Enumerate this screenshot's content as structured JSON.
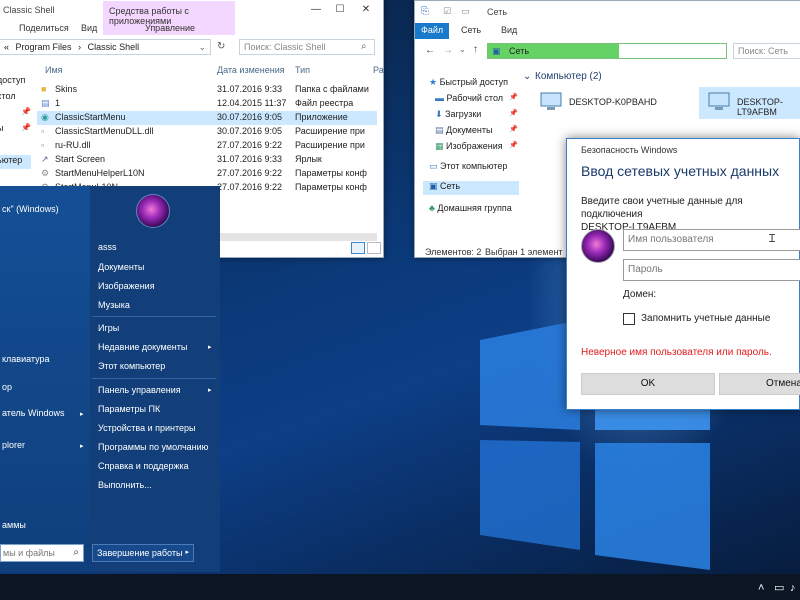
{
  "desktop": {
    "accent": "#0b3a7a",
    "logo_color": "#6fbaff"
  },
  "explorer1": {
    "title": "Classic Shell",
    "tool_tab_label": "Средства работы с приложениями",
    "tabs": [
      "Поделиться",
      "Вид",
      "Управление"
    ],
    "breadcrumb": [
      "«",
      "Program Files",
      "›",
      "Classic Shell"
    ],
    "search_placeholder": "Поиск: Classic Shell",
    "columns": [
      "Имя",
      "Дата изменения",
      "Тип",
      "Ра"
    ],
    "nav_partial": [
      "доступ",
      "стол",
      "",
      "",
      "ы",
      "ьютер"
    ],
    "files": [
      {
        "name": "Skins",
        "date": "31.07.2016 9:33",
        "type": "Папка с файлами",
        "icon": "folder-icon"
      },
      {
        "name": "1",
        "date": "12.04.2015 11:37",
        "type": "Файл реестра",
        "icon": "registry-file-icon"
      },
      {
        "name": "ClassicStartMenu",
        "date": "30.07.2016 9:05",
        "type": "Приложение",
        "icon": "app-icon"
      },
      {
        "name": "ClassicStartMenuDLL.dll",
        "date": "30.07.2016 9:05",
        "type": "Расширение при",
        "icon": "dll-icon"
      },
      {
        "name": "ru-RU.dll",
        "date": "27.07.2016 9:22",
        "type": "Расширение при",
        "icon": "dll-icon"
      },
      {
        "name": "Start Screen",
        "date": "31.07.2016 9:33",
        "type": "Ярлык",
        "icon": "shortcut-icon"
      },
      {
        "name": "StartMenuHelperL10N",
        "date": "27.07.2016 9:22",
        "type": "Параметры конф",
        "icon": "config-icon"
      },
      {
        "name": "StartMenuL10N",
        "date": "27.07.2016 9:22",
        "type": "Параметры конф",
        "icon": "config-icon"
      }
    ]
  },
  "explorer2": {
    "title": "Сеть",
    "tabs": [
      "Файл",
      "Сеть",
      "Вид"
    ],
    "address": "Сеть",
    "search_placeholder": "Поиск: Сеть",
    "nav": [
      {
        "label": "Быстрый доступ",
        "icon": "star-icon"
      },
      {
        "label": "Рабочий стол",
        "icon": "desktop-icon"
      },
      {
        "label": "Загрузки",
        "icon": "download-icon"
      },
      {
        "label": "Документы",
        "icon": "document-icon"
      },
      {
        "label": "Изображения",
        "icon": "pictures-icon"
      },
      {
        "label": "Этот компьютер",
        "icon": "computer-icon"
      },
      {
        "label": "Сеть",
        "icon": "network-icon"
      },
      {
        "label": "Домашняя группа",
        "icon": "homegroup-icon"
      }
    ],
    "group_header": "Компьютер (2)",
    "computers": [
      "DESKTOP-K0PBAHD",
      "DESKTOP-LT9AFBM"
    ],
    "status_items": "Элементов: 2",
    "status_selected": "Выбран 1 элемент"
  },
  "start_menu": {
    "left_items": [
      "ск\" (Windows)",
      "клавиатура",
      "ор",
      "атель Windows",
      "plorer",
      "аммы"
    ],
    "search_placeholder": "мы и файлы",
    "user_name": "asss",
    "right_items": [
      {
        "label": "Документы",
        "arrow": false
      },
      {
        "label": "Изображения",
        "arrow": false
      },
      {
        "label": "Музыка",
        "arrow": false
      },
      {
        "label": "Игры",
        "arrow": false
      },
      {
        "label": "Недавние документы",
        "arrow": true
      },
      {
        "label": "Этот компьютер",
        "arrow": false
      },
      {
        "label": "Панель управления",
        "arrow": true
      },
      {
        "label": "Параметры ПК",
        "arrow": false
      },
      {
        "label": "Устройства и принтеры",
        "arrow": false
      },
      {
        "label": "Программы по умолчанию",
        "arrow": false
      },
      {
        "label": "Справка и поддержка",
        "arrow": false
      },
      {
        "label": "Выполнить...",
        "arrow": false
      }
    ],
    "shutdown_label": "Завершение работы"
  },
  "dialog": {
    "title": "Безопасность Windows",
    "heading": "Ввод сетевых учетных данных",
    "prompt_line1": "Введите свои учетные данные для подключения",
    "prompt_line2": "DESKTOP-LT9AFBM",
    "username_placeholder": "Имя пользователя",
    "password_placeholder": "Пароль",
    "domain_label": "Домен:",
    "remember_label": "Запомнить учетные данные",
    "error_text": "Неверное имя пользователя или пароль.",
    "ok_label": "OK",
    "cancel_label": "Отмена",
    "error_color": "#e01d1d"
  }
}
